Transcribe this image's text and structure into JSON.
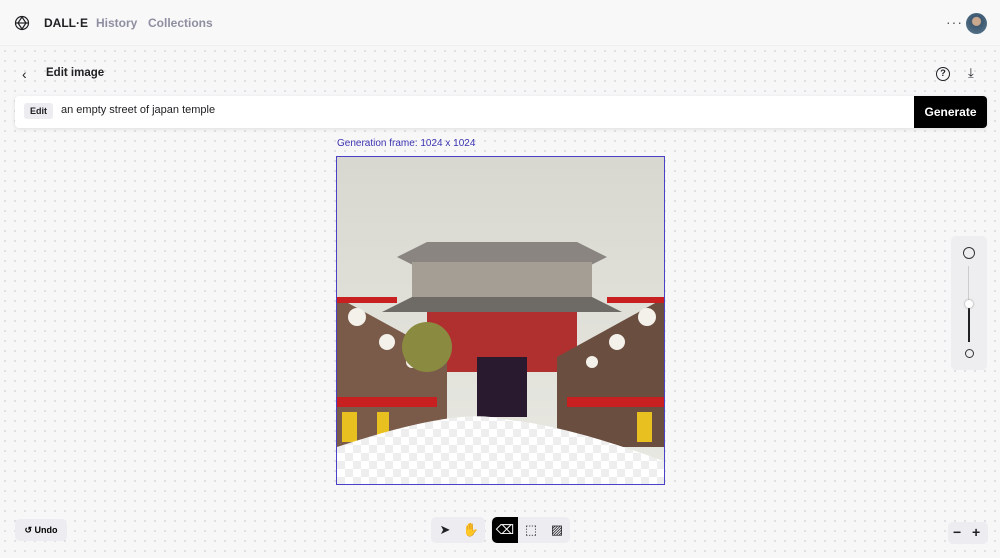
{
  "topbar": {
    "brand": "DALL·E",
    "nav": [
      "History",
      "Collections"
    ],
    "more": "···"
  },
  "header": {
    "title": "Edit image",
    "back": "‹",
    "help": "?",
    "download": "⤓"
  },
  "prompt": {
    "badge": "Edit",
    "value": "an empty street of japan temple",
    "generate": "Generate"
  },
  "frame": {
    "label": "Generation frame: 1024 x 1024"
  },
  "zoom_slider": {
    "level": 0.5
  },
  "toolbar": {
    "undo": "Undo",
    "tools": [
      "select",
      "pan",
      "eraser",
      "add-frame",
      "upload-image"
    ],
    "active": "eraser",
    "zoom_out": "−",
    "zoom_in": "+"
  },
  "colors": {
    "accent": "#4b40c8",
    "generate_bg": "#000000"
  }
}
